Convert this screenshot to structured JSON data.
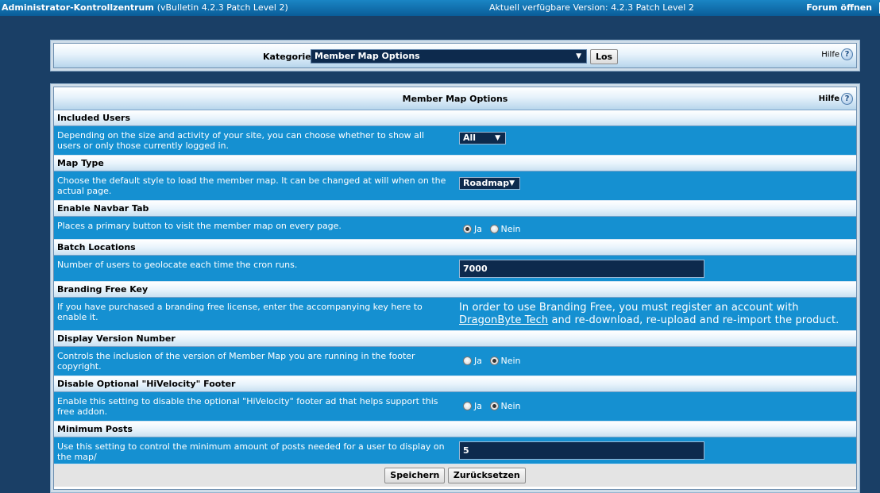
{
  "topbar": {
    "title": "Administrator-Kontrollzentrum",
    "subtitle": "(vBulletin 4.2.3 Patch Level 2)",
    "version": "Aktuell verfügbare Version: 4.2.3 Patch Level 2",
    "open_forum": "Forum öffnen"
  },
  "category": {
    "label": "Kategorie",
    "selected": "Member Map Options",
    "go_button": "Los",
    "help": "Hilfe"
  },
  "options": {
    "title": "Member Map Options",
    "help": "Hilfe",
    "sections": [
      {
        "title": "Included Users",
        "desc": "Depending on the size and activity of your site, you can choose whether to show all users or only those currently logged in.",
        "value": "All"
      },
      {
        "title": "Map Type",
        "desc": "Choose the default style to load the member map. It can be changed at will when on the actual page.",
        "value": "Roadmap"
      },
      {
        "title": "Enable Navbar Tab",
        "desc": "Places a primary button to visit the member map on every page.",
        "yes": "Ja",
        "no": "Nein",
        "selected": "Ja"
      },
      {
        "title": "Batch Locations",
        "desc": "Number of users to geolocate each time the cron runs.",
        "value": "7000"
      },
      {
        "title": "Branding Free Key",
        "desc": "If you have purchased a branding free license, enter the accompanying key here to enable it.",
        "msg_pre": "In order to use Branding Free, you must register an account with",
        "msg_link": "DragonByte Tech",
        "msg_post": " and re-download, re-upload and re-import the product."
      },
      {
        "title": "Display Version Number",
        "desc": "Controls the inclusion of the version of Member Map you are running in the footer copyright.",
        "yes": "Ja",
        "no": "Nein",
        "selected": "Nein"
      },
      {
        "title": "Disable Optional \"HiVelocity\" Footer",
        "desc": "Enable this setting to disable the optional \"HiVelocity\" footer ad that helps support this free addon.",
        "yes": "Ja",
        "no": "Nein",
        "selected": "Nein"
      },
      {
        "title": "Minimum Posts",
        "desc": "Use this setting to control the minimum amount of posts needed for a user to display on the map/",
        "value": "5"
      }
    ],
    "save_button": "Speichern",
    "reset_button": "Zurücksetzen"
  }
}
